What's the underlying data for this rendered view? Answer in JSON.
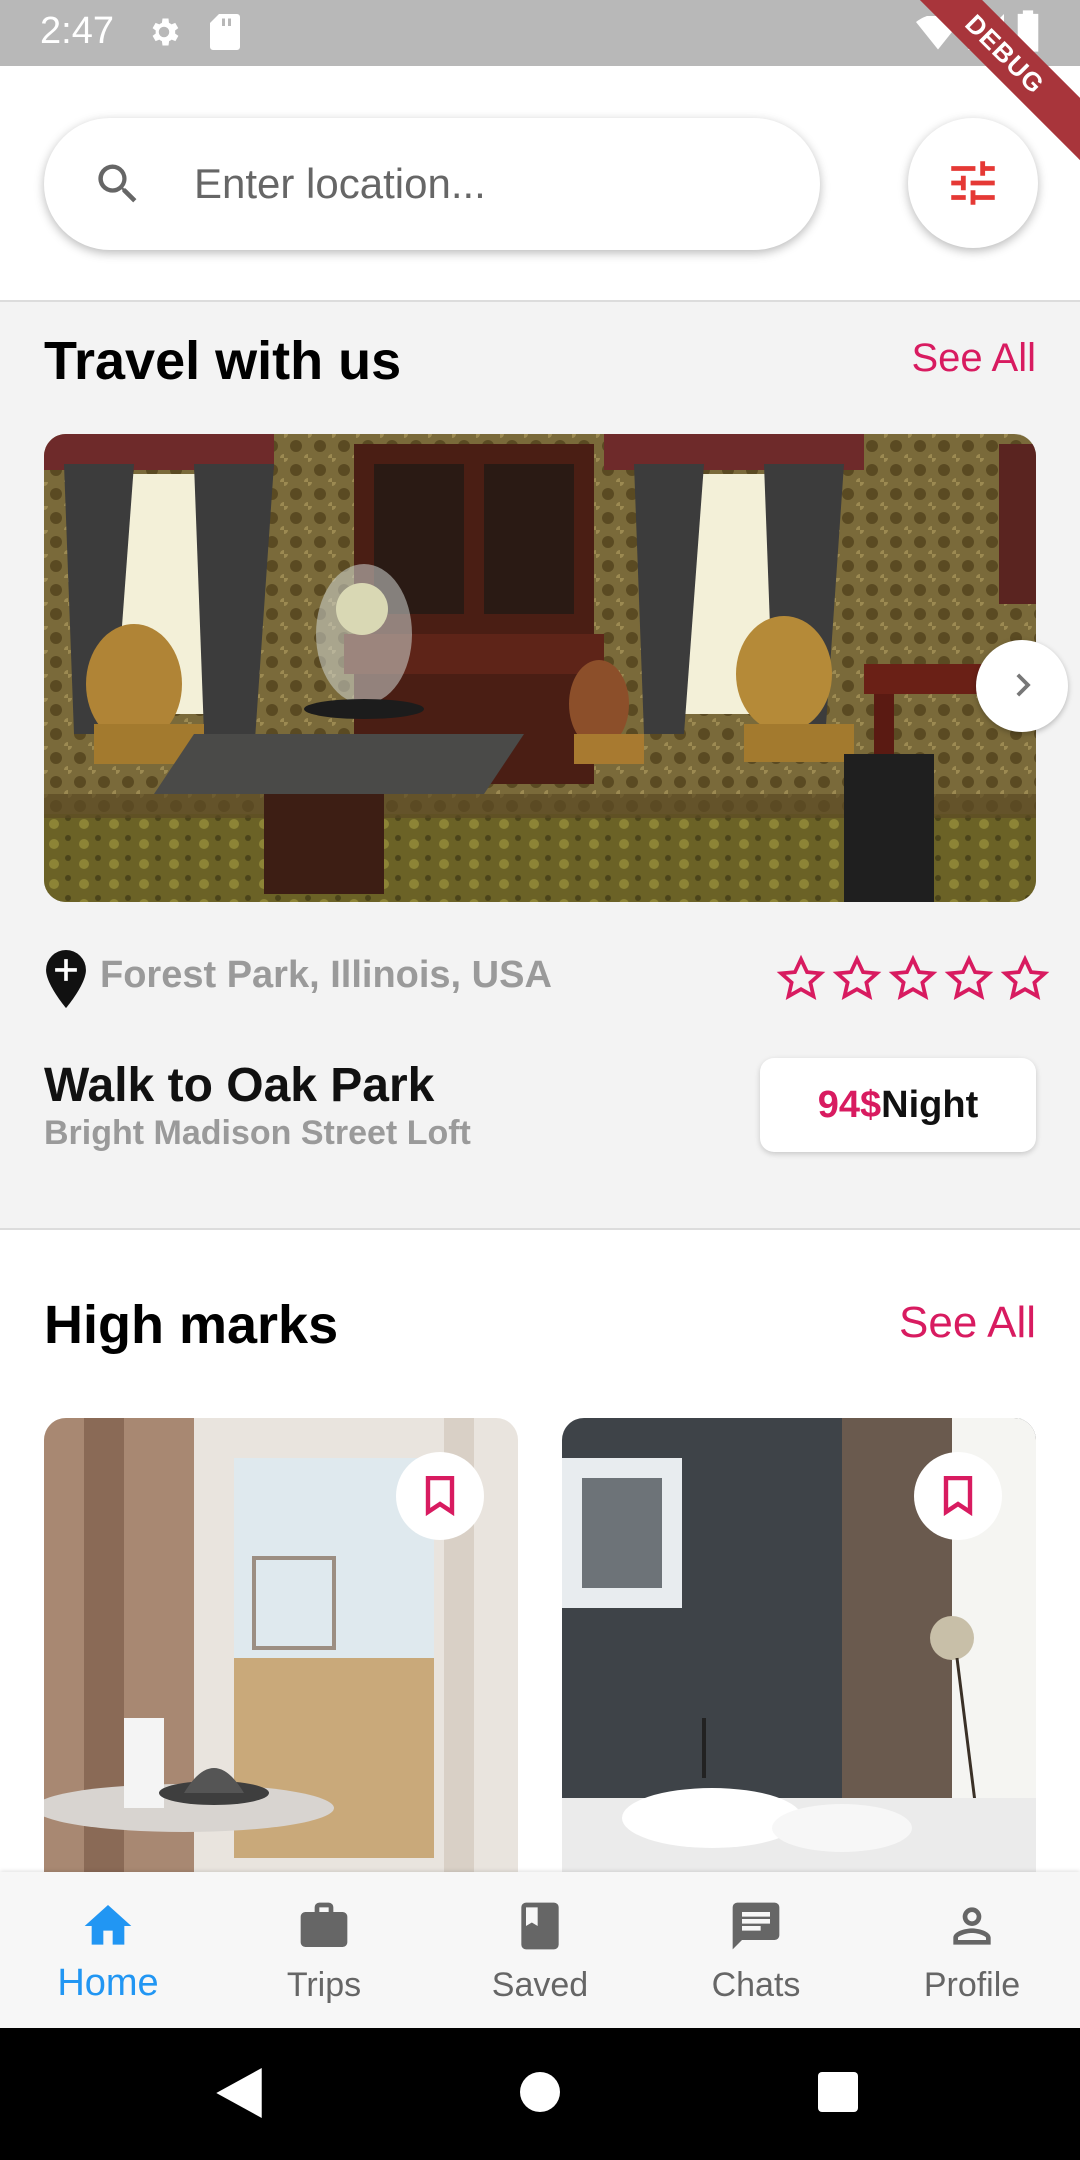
{
  "status_bar": {
    "time": "2:47",
    "debug_label": "DEBUG"
  },
  "search": {
    "placeholder": "Enter location...",
    "search_icon": "search-icon",
    "filter_icon": "tune-icon"
  },
  "travel_section": {
    "title": "Travel with us",
    "see_all": "See All",
    "listing": {
      "location": "Forest Park, Illinois, USA",
      "rating_max": 5,
      "rating": 0,
      "title": "Walk to Oak Park",
      "subtitle": "Bright Madison Street Loft",
      "price_amount": "94$",
      "price_unit": "Night"
    }
  },
  "high_marks": {
    "title": "High marks",
    "see_all": "See All"
  },
  "bottom_nav": {
    "items": [
      {
        "label": "Home",
        "icon": "home-icon",
        "active": true
      },
      {
        "label": "Trips",
        "icon": "briefcase-icon",
        "active": false
      },
      {
        "label": "Saved",
        "icon": "book-icon",
        "active": false
      },
      {
        "label": "Chats",
        "icon": "chat-icon",
        "active": false
      },
      {
        "label": "Profile",
        "icon": "person-icon",
        "active": false
      }
    ]
  },
  "colors": {
    "accent": "#d81b60",
    "nav_active": "#2196f3",
    "muted_text": "#9a9a9a"
  }
}
